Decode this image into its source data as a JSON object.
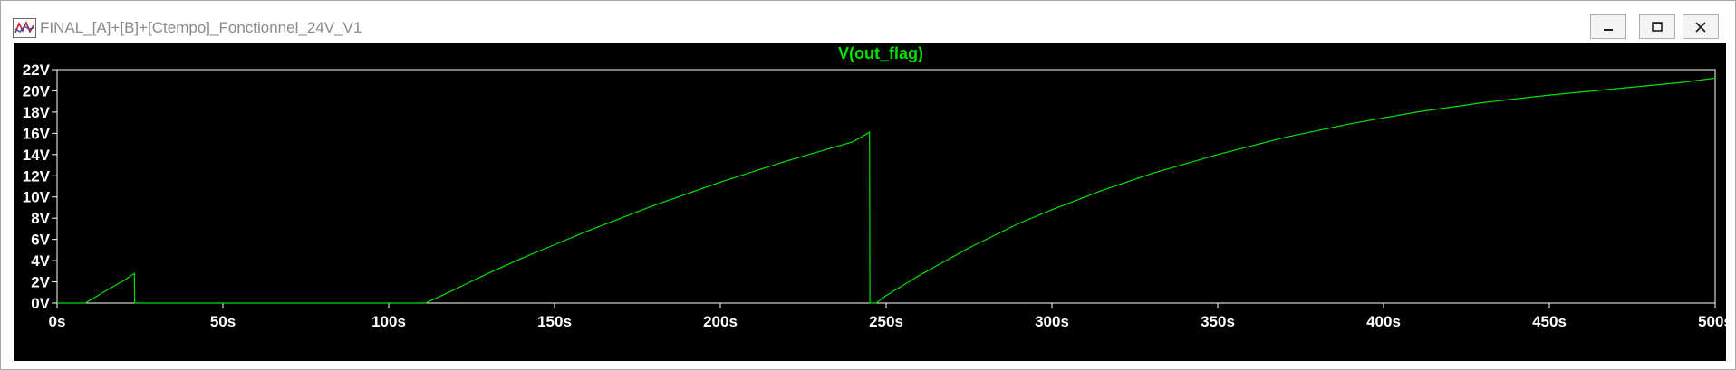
{
  "window": {
    "title": "FINAL_[A]+[B]+[Ctempo]_Fonctionnel_24V_V1",
    "icon": "waveform-viewer-icon",
    "controls": {
      "minimize": "minimize-icon",
      "maximize": "maximize-icon",
      "close": "close-icon"
    }
  },
  "colors": {
    "trace": "#00e000",
    "background": "#000000",
    "frame": "#ffffff",
    "text": "#ffffff"
  },
  "chart_data": {
    "type": "line",
    "title": "V(out_flag)",
    "xlabel": "",
    "ylabel": "",
    "xlim": [
      0,
      500
    ],
    "ylim": [
      0,
      22
    ],
    "x_ticks": [
      "0s",
      "50s",
      "100s",
      "150s",
      "200s",
      "250s",
      "300s",
      "350s",
      "400s",
      "450s",
      "500s"
    ],
    "x_tick_values": [
      0,
      50,
      100,
      150,
      200,
      250,
      300,
      350,
      400,
      450,
      500
    ],
    "y_ticks": [
      "0V",
      "2V",
      "4V",
      "6V",
      "8V",
      "10V",
      "12V",
      "14V",
      "16V",
      "18V",
      "20V",
      "22V"
    ],
    "y_tick_values": [
      0,
      2,
      4,
      6,
      8,
      10,
      12,
      14,
      16,
      18,
      20,
      22
    ],
    "grid": false,
    "series": [
      {
        "name": "V(out_flag)",
        "x": [
          0,
          8.5,
          12,
          16,
          20,
          23.3,
          23.4,
          60,
          111,
          111.1,
          120,
          130,
          140,
          150,
          160,
          170,
          180,
          190,
          200,
          210,
          220,
          230,
          240,
          245,
          245.1,
          247,
          250,
          260,
          275,
          290,
          300,
          315,
          330,
          350,
          370,
          390,
          410,
          430,
          450,
          470,
          490,
          500
        ],
        "y": [
          0,
          0,
          0.65,
          1.4,
          2.1,
          2.8,
          0,
          0,
          0,
          0,
          1.3,
          2.8,
          4.2,
          5.5,
          6.8,
          8.0,
          9.2,
          10.3,
          11.4,
          12.4,
          13.4,
          14.3,
          15.2,
          16.1,
          0,
          0,
          0.7,
          2.6,
          5.2,
          7.5,
          8.8,
          10.6,
          12.2,
          14.0,
          15.6,
          16.9,
          18.0,
          18.9,
          19.6,
          20.2,
          20.8,
          21.2
        ]
      }
    ]
  }
}
